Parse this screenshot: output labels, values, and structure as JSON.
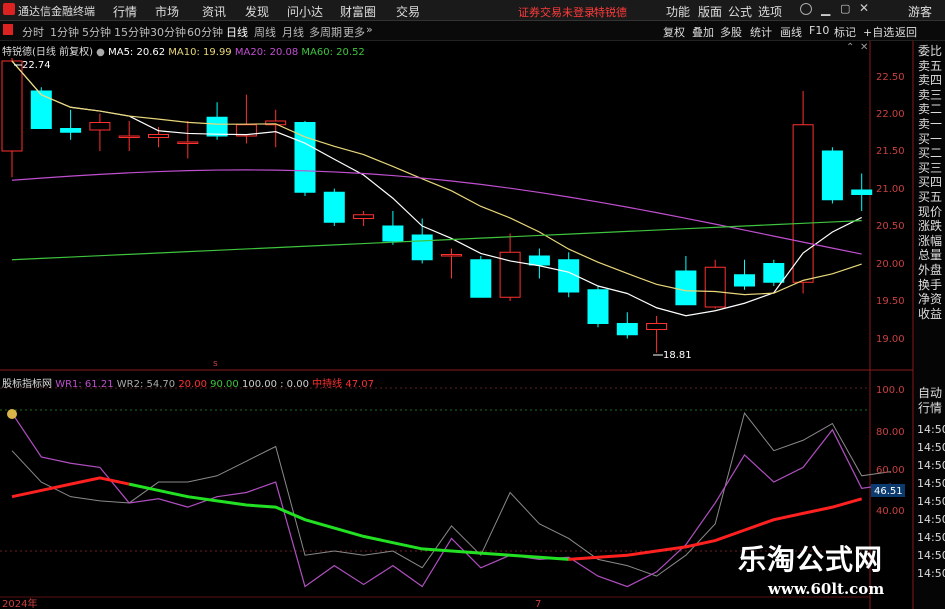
{
  "menubar": {
    "app_name": "通达信金融终端",
    "items": [
      "行情",
      "市场",
      "资讯",
      "发现",
      "问小达",
      "财富圈",
      "交易"
    ],
    "notice": "证券交易未登录",
    "stock_name": "特锐德",
    "right_items": [
      "功能",
      "版面",
      "公式",
      "选项"
    ],
    "right_label": "游客"
  },
  "periodbar": {
    "periods": [
      "分时",
      "1分钟",
      "5分钟",
      "15分钟",
      "30分钟",
      "60分钟",
      "日线",
      "周线",
      "月线",
      "多周期",
      "更多"
    ],
    "active": "日线",
    "tools": [
      "复权",
      "叠加",
      "多股",
      "统计",
      "画线",
      "F10",
      "标记",
      "+自选",
      "返回"
    ]
  },
  "main": {
    "stock": "特锐德",
    "mode": "(日线 前复权)",
    "ma": [
      {
        "label": "MA5: 20.62",
        "color": "#ffffff"
      },
      {
        "label": "MA10: 19.99",
        "color": "#e8d77a"
      },
      {
        "label": "MA20: 20.08",
        "color": "#c04fd0"
      },
      {
        "label": "MA60: 20.52",
        "color": "#3ec43e"
      }
    ],
    "high_label": "22.74",
    "low_label": "18.81",
    "y_ticks": [
      "22.50",
      "22.00",
      "21.50",
      "21.00",
      "20.50",
      "20.00",
      "19.50",
      "19.00"
    ],
    "y_range": [
      18.7,
      22.9
    ]
  },
  "candles": [
    {
      "o": 21.5,
      "c": 22.7,
      "h": 22.74,
      "l": 21.15
    },
    {
      "o": 22.3,
      "c": 21.8,
      "h": 22.35,
      "l": 21.8
    },
    {
      "o": 21.8,
      "c": 21.75,
      "h": 22.05,
      "l": 21.65
    },
    {
      "o": 21.78,
      "c": 21.88,
      "h": 22.0,
      "l": 21.5
    },
    {
      "o": 21.7,
      "c": 21.7,
      "h": 21.9,
      "l": 21.5
    },
    {
      "o": 21.68,
      "c": 21.72,
      "h": 21.82,
      "l": 21.55
    },
    {
      "o": 21.6,
      "c": 21.62,
      "h": 21.9,
      "l": 21.4
    },
    {
      "o": 21.95,
      "c": 21.7,
      "h": 22.15,
      "l": 21.65
    },
    {
      "o": 21.7,
      "c": 21.85,
      "h": 22.25,
      "l": 21.6
    },
    {
      "o": 21.85,
      "c": 21.9,
      "h": 22.05,
      "l": 21.55
    },
    {
      "o": 21.88,
      "c": 20.95,
      "h": 21.9,
      "l": 20.9
    },
    {
      "o": 20.95,
      "c": 20.55,
      "h": 21.0,
      "l": 20.5
    },
    {
      "o": 20.6,
      "c": 20.65,
      "h": 20.7,
      "l": 20.5
    },
    {
      "o": 20.5,
      "c": 20.3,
      "h": 20.7,
      "l": 20.25
    },
    {
      "o": 20.38,
      "c": 20.05,
      "h": 20.6,
      "l": 20.0
    },
    {
      "o": 20.1,
      "c": 20.12,
      "h": 20.2,
      "l": 19.8
    },
    {
      "o": 20.05,
      "c": 19.55,
      "h": 20.1,
      "l": 19.55
    },
    {
      "o": 19.55,
      "c": 20.15,
      "h": 20.4,
      "l": 19.5
    },
    {
      "o": 20.1,
      "c": 19.98,
      "h": 20.2,
      "l": 19.8
    },
    {
      "o": 20.05,
      "c": 19.62,
      "h": 20.15,
      "l": 19.55
    },
    {
      "o": 19.65,
      "c": 19.2,
      "h": 19.7,
      "l": 19.15
    },
    {
      "o": 19.2,
      "c": 19.05,
      "h": 19.35,
      "l": 19.0
    },
    {
      "o": 19.12,
      "c": 19.2,
      "h": 19.3,
      "l": 18.81
    },
    {
      "o": 19.9,
      "c": 19.45,
      "h": 20.1,
      "l": 19.45
    },
    {
      "o": 19.42,
      "c": 19.95,
      "h": 20.05,
      "l": 19.4
    },
    {
      "o": 19.85,
      "c": 19.7,
      "h": 20.05,
      "l": 19.65
    },
    {
      "o": 20.0,
      "c": 19.75,
      "h": 20.05,
      "l": 19.7
    },
    {
      "o": 19.75,
      "c": 21.85,
      "h": 22.3,
      "l": 19.6
    },
    {
      "o": 21.5,
      "c": 20.85,
      "h": 21.55,
      "l": 20.8
    },
    {
      "o": 20.98,
      "c": 20.92,
      "h": 21.2,
      "l": 20.7
    }
  ],
  "sub": {
    "title": "股标指标网",
    "wr1": "WR1: 61.21",
    "wr2": "WR2: 54.70",
    "v1": "20.00",
    "v2": "90.00",
    "v3": "100.00 : 0.00",
    "mid_label": "中持线",
    "mid_value": "47.07",
    "y_ticks": [
      "100.0",
      "80.00",
      "60.00",
      "40.00"
    ],
    "current_value": "46.51",
    "x_labels": [
      "2024年",
      "7"
    ]
  },
  "right_panel": {
    "items": [
      "委比",
      "卖五",
      "卖四",
      "卖三",
      "卖二",
      "卖一",
      "买一",
      "买二",
      "买三",
      "买四",
      "买五",
      "现价",
      "涨跌",
      "涨幅",
      "总量",
      "外盘",
      "换手",
      "净资",
      "收益"
    ],
    "sub_items": [
      "自动",
      "行情"
    ],
    "time_items": [
      "14:50",
      "14:50",
      "14:50",
      "14:50",
      "14:50",
      "14:50",
      "14:50",
      "14:50",
      "14:50"
    ]
  },
  "watermark": {
    "cn": "乐淘公式网",
    "url": "www.60lt.com"
  },
  "colors": {
    "up": "#ff3030",
    "down": "#00ffff",
    "ma5": "#ffffff",
    "ma10": "#e8d77a",
    "ma20": "#c04fd0",
    "ma60": "#3ec43e"
  }
}
